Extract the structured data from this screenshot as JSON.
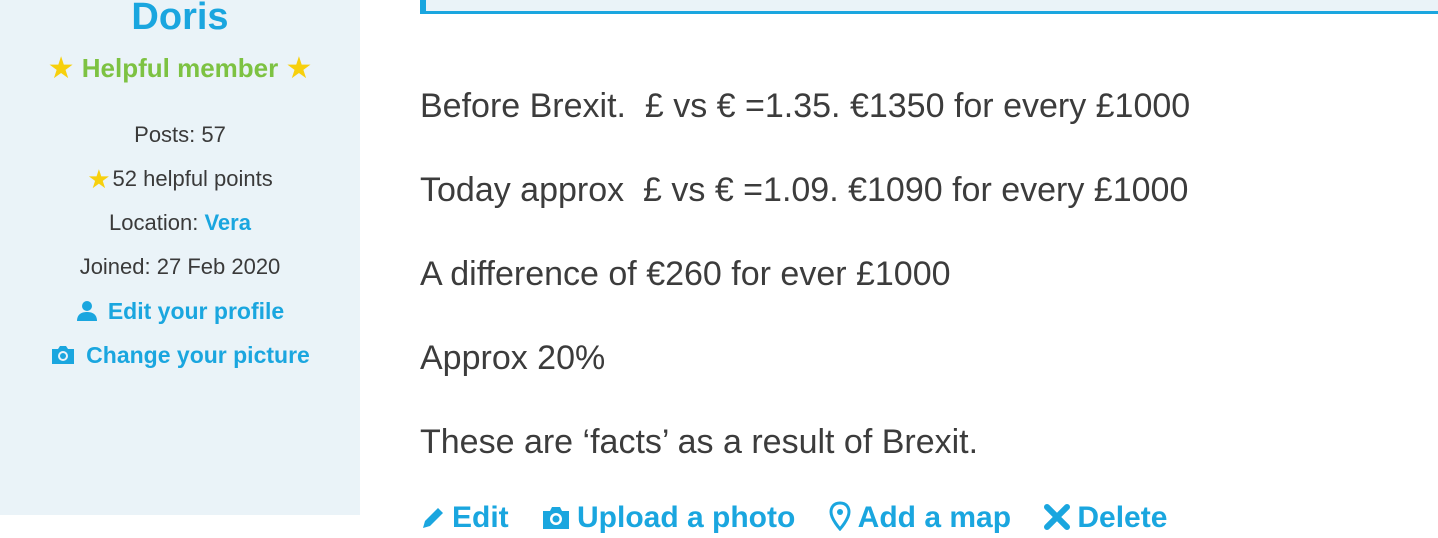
{
  "profile": {
    "username": "Doris",
    "rank": "Helpful member",
    "posts": "Posts: 57",
    "helpful_points": "52 helpful points",
    "location_label": "Location: ",
    "location_value": "Vera",
    "joined": "Joined: 27 Feb 2020",
    "edit_profile": "Edit your profile",
    "change_picture": "Change your picture"
  },
  "post": {
    "lines": [
      "Before Brexit.  £ vs € =1.35. €1350 for every £1000",
      "Today approx  £ vs € =1.09. €1090 for every £1000",
      "A difference of €260 for ever £1000",
      "Approx 20%",
      "These are ‘facts’ as a result of Brexit."
    ]
  },
  "actions": {
    "edit": "Edit",
    "upload": "Upload a photo",
    "add": "Add a map",
    "delete": "Delete"
  },
  "colors": {
    "accent": "#1aa6df",
    "rank": "#7dc242",
    "star": "#f7d00d",
    "sidebar_bg": "#eaf3f8"
  }
}
